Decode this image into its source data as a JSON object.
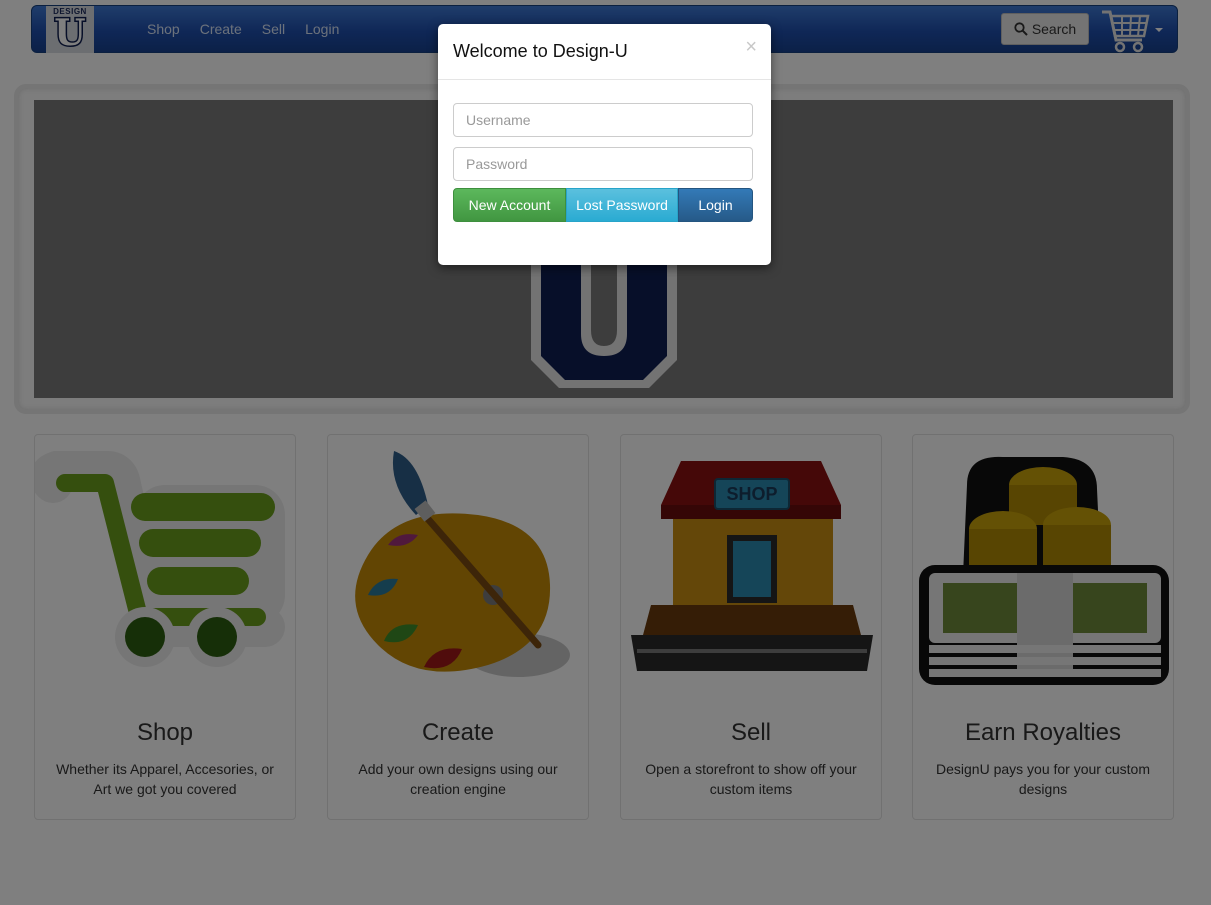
{
  "navbar": {
    "logo_top": "DESIGN",
    "logo_letter": "U",
    "links": [
      "Shop",
      "Create",
      "Sell",
      "Login"
    ],
    "search_label": "Search",
    "search_icon": "search-icon",
    "cart_icon": "shopping-cart-icon"
  },
  "hero": {
    "logo_letter": "U"
  },
  "features": [
    {
      "title": "Shop",
      "text": "Whether its Apparel, Accesories, or Art we got you covered",
      "icon": "green-cart-icon"
    },
    {
      "title": "Create",
      "text": "Add your own designs using our creation engine",
      "icon": "paint-palette-icon"
    },
    {
      "title": "Sell",
      "text": "Open a storefront to show off your custom items",
      "icon": "storefront-icon"
    },
    {
      "title": "Earn Royalties",
      "text": "DesignU pays you for your custom designs",
      "icon": "money-coins-icon"
    }
  ],
  "modal": {
    "title": "Welcome to Design-U",
    "close": "×",
    "username_placeholder": "Username",
    "password_placeholder": "Password",
    "buttons": {
      "new_account": "New Account",
      "lost_password": "Lost Password",
      "login": "Login"
    }
  },
  "colors": {
    "navbar": "#1f4fae",
    "btn_green": "#5cb85c",
    "btn_cyan": "#5bc0de",
    "btn_blue": "#337ab7"
  }
}
